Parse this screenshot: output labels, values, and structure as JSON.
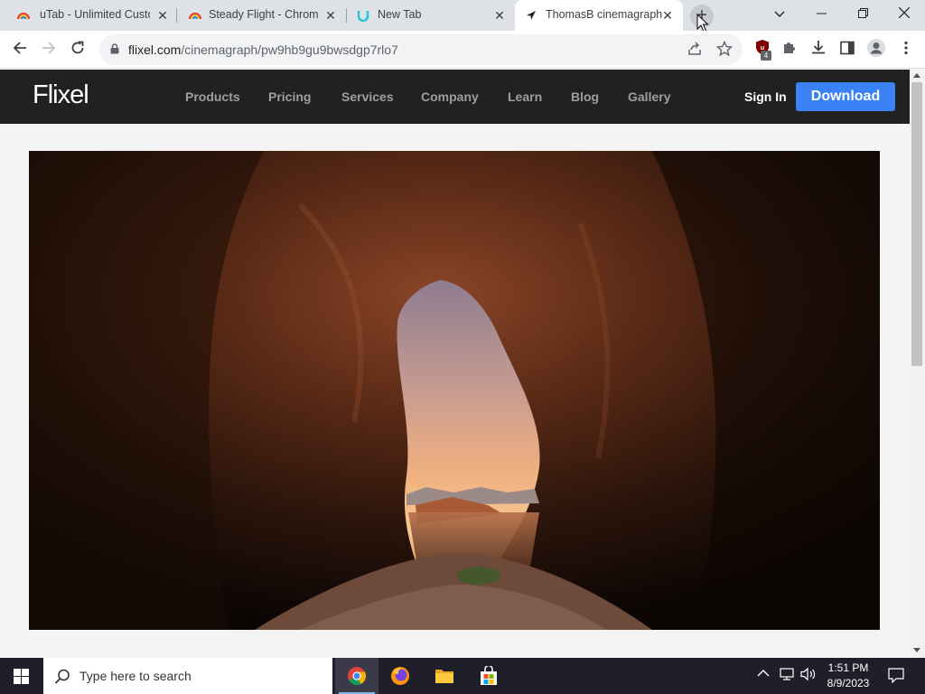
{
  "browser": {
    "tabs": [
      {
        "title": "uTab - Unlimited Custo",
        "active": false
      },
      {
        "title": "Steady Flight - Chrome",
        "active": false
      },
      {
        "title": "New Tab",
        "active": false
      },
      {
        "title": "ThomasB cinemagraph",
        "active": true
      }
    ],
    "new_tab_symbol": "+",
    "url_host": "flixel.com",
    "url_path": "/cinemagraph/pw9hb9gu9bwsdgp7rlo7",
    "extension_badge": "4"
  },
  "site": {
    "logo": "Flixel",
    "nav": [
      "Products",
      "Pricing",
      "Services",
      "Company",
      "Learn",
      "Blog",
      "Gallery"
    ],
    "sign_in": "Sign In",
    "download": "Download",
    "accent_color": "#3b82f6"
  },
  "taskbar": {
    "search_placeholder": "Type here to search",
    "time": "1:51 PM",
    "date": "8/9/2023"
  }
}
